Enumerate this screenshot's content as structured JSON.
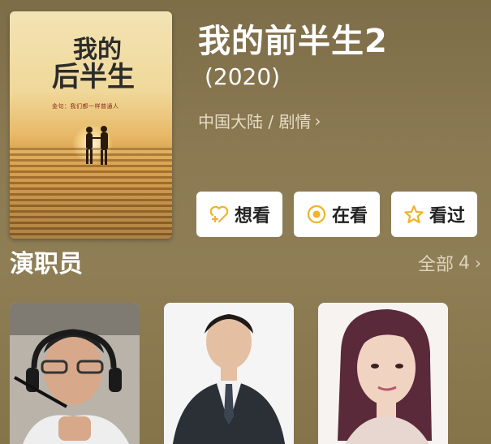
{
  "poster": {
    "title_art": "我的后半生",
    "tagline": "金句：我们都一样普通人"
  },
  "movie": {
    "title": "我的前半生2",
    "year": "(2020)",
    "genre": "中国大陆 / 剧情"
  },
  "actions": [
    {
      "label": "想看",
      "icon": "heart-plus-icon"
    },
    {
      "label": "在看",
      "icon": "circle-dot-icon"
    },
    {
      "label": "看过",
      "icon": "star-icon"
    }
  ],
  "cast": {
    "title": "演职员",
    "all_label": "全部",
    "count": "4",
    "members": [
      {
        "role": "director"
      },
      {
        "role": "actor"
      },
      {
        "role": "actress"
      }
    ]
  },
  "colors": {
    "background": "#8a7a52",
    "accent": "#f0b429"
  }
}
